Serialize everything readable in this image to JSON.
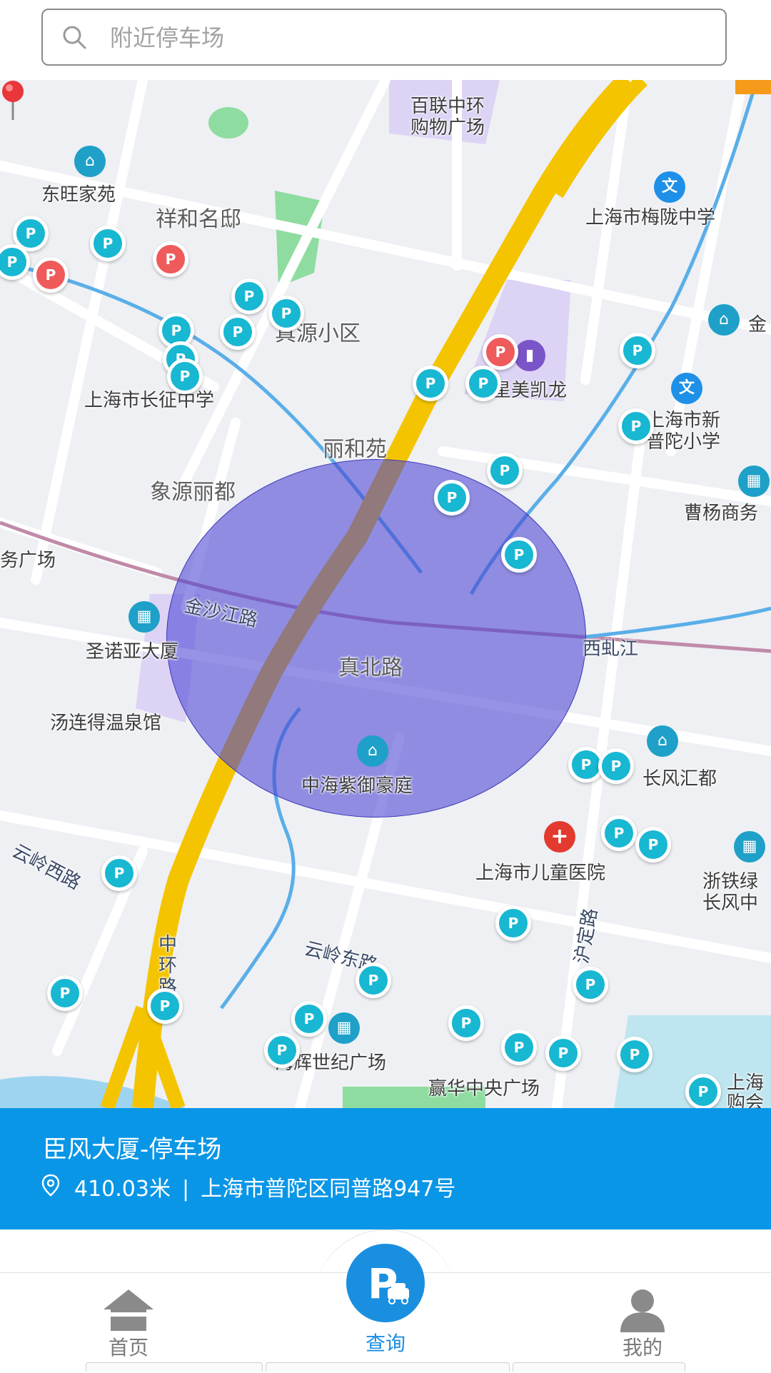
{
  "search": {
    "placeholder": "附近停车场",
    "value": ""
  },
  "map": {
    "colors": {
      "radius_fill": "#4a43d4",
      "road_main": "#f5c400",
      "parking_pin": "#18b7d2",
      "parking_pin_red": "#ef5a5a"
    },
    "area_labels": [
      "百联中环",
      "购物广场",
      "东旺家苑",
      "祥和名邸",
      "上海市梅陇中学",
      "真源小区",
      "金",
      "星美凯龙",
      "上海市长征中学",
      "上海市新",
      "普陀小学",
      "丽和苑",
      "象源丽都",
      "曹杨商务",
      "务广场",
      "金沙江路",
      "圣诺亚大厦",
      "西虬江",
      "真北路",
      "汤连得温泉馆",
      "中海紫御豪庭",
      "长风汇都",
      "上海市儿童医院",
      "浙铁绿",
      "长风中",
      "云岭西路",
      "中",
      "环",
      "路",
      "云岭东路",
      "沪定路",
      "海辉世纪广场",
      "赢华中央广场",
      "上海",
      "购会"
    ],
    "parking_pin_label": "P",
    "current_location": "真北路"
  },
  "info_panel": {
    "name": "臣风大厦-停车场",
    "distance": "410.03米",
    "separator": "|",
    "address": "上海市普陀区同普路947号"
  },
  "nav": {
    "home": "首页",
    "query": "查询",
    "mine": "我的",
    "active": "查询"
  }
}
